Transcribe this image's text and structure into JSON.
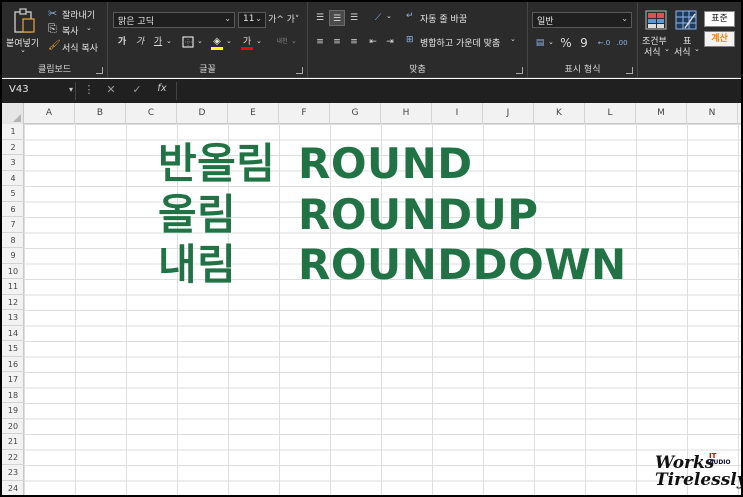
{
  "ribbon": {
    "clipboard": {
      "paste_label": "붙여넣기",
      "cut_label": "잘라내기",
      "copy_label": "복사",
      "format_painter_label": "서식 복사",
      "group_label": "클립보드"
    },
    "font": {
      "font_name": "맑은 고딕",
      "font_size": "11",
      "grow_label": "가^",
      "shrink_label": "가˅",
      "bold_label": "가",
      "italic_label": "가",
      "underline_label": "가",
      "phonetic_label": "내천",
      "group_label": "글꼴"
    },
    "alignment": {
      "wrap_text_label": "자동 줄 바꿈",
      "merge_center_label": "병합하고 가운데 맞춤",
      "group_label": "맞춤"
    },
    "number": {
      "format": "일반",
      "percent_label": "%",
      "comma_label": "9",
      "group_label": "표시 형식"
    },
    "styles": {
      "conditional_label_1": "조건부",
      "conditional_label_2": "서식",
      "table_label_1": "표",
      "table_label_2": "서식",
      "style_normal": "표준",
      "style_calc": "계산"
    }
  },
  "formula_bar": {
    "name_box": "V43",
    "fx_label": "fx"
  },
  "grid": {
    "columns": [
      "A",
      "B",
      "C",
      "D",
      "E",
      "F",
      "G",
      "H",
      "I",
      "J",
      "K",
      "L",
      "M",
      "N"
    ],
    "rows": [
      "1",
      "2",
      "3",
      "4",
      "5",
      "6",
      "7",
      "8",
      "9",
      "10",
      "11",
      "12",
      "13",
      "14",
      "15",
      "16",
      "17",
      "18",
      "19",
      "20",
      "21",
      "22",
      "23",
      "24"
    ],
    "content": [
      {
        "korean": "반올림",
        "english": "ROUND"
      },
      {
        "korean": "올림",
        "english": "ROUNDUP"
      },
      {
        "korean": "내림",
        "english": "ROUNDDOWN"
      }
    ]
  },
  "watermark": {
    "line1": "Works",
    "line2": "Tirelessly",
    "tag_it": "IT",
    "tag_audio": "AUDIO"
  },
  "colors": {
    "accent_green": "#217346",
    "ribbon_bg": "#2b2b2b"
  }
}
